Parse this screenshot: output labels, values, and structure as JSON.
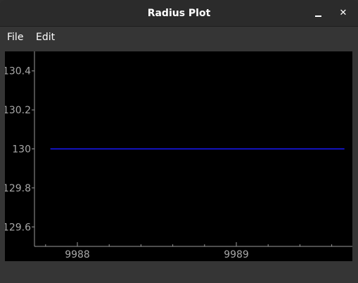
{
  "window": {
    "title": "Radius Plot",
    "minimize_label": "–",
    "close_label": "✕"
  },
  "menubar": {
    "items": [
      "File",
      "Edit"
    ]
  },
  "colors": {
    "plot_background": "#000000",
    "axis": "#9a9a9a",
    "tick_label": "#a8a8a8",
    "series": "#1a1aff"
  },
  "chart_data": {
    "type": "line",
    "xlim": [
      9987.73,
      9989.73
    ],
    "ylim": [
      129.5,
      130.5
    ],
    "x_ticks": [
      9988,
      9989
    ],
    "x_tick_labels": [
      "9988",
      "9989"
    ],
    "y_ticks": [
      129.6,
      129.8,
      130,
      130.2,
      130.4
    ],
    "y_tick_labels": [
      "129.6",
      "129.8",
      "130",
      "130.2",
      "130.4"
    ],
    "x_minor_ticks": [
      9987.8,
      9988.2,
      9988.4,
      9988.6,
      9988.8,
      9989.2,
      9989.4,
      9989.6
    ],
    "series": [
      {
        "x": [
          9987.83,
          9989.68
        ],
        "y": [
          130,
          130
        ]
      }
    ]
  }
}
